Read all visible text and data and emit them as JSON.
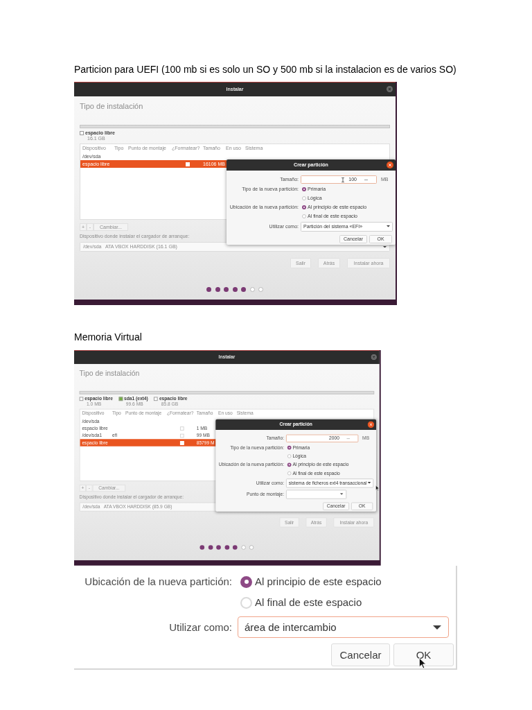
{
  "sections": [
    {
      "caption": "Particion para UEFI (100 mb si es solo un SO y 500 mb si la instalacion es de varios SO)",
      "screenshot": {
        "window_title": "Instalar",
        "heading": "Tipo de instalación",
        "legend": [
          {
            "label": "espacio libre",
            "size": "16.1 GB",
            "color": "#ffffff"
          }
        ],
        "table": {
          "columns": [
            "Dispositivo",
            "Tipo",
            "Punto de montaje",
            "¿Formatear?",
            "Tamaño",
            "En uso",
            "Sistema"
          ],
          "rows": [
            {
              "device": "/dev/sda",
              "selected": false
            },
            {
              "device": "espacio libre",
              "format": false,
              "size": "16106 MB",
              "selected": true
            }
          ]
        },
        "table_buttons": [
          {
            "label": "+",
            "disabled": true
          },
          {
            "label": "-",
            "disabled": true
          },
          {
            "label": "Cambiar...",
            "disabled": true
          }
        ],
        "bootloader": {
          "label": "Dispositivo donde instalar el cargador de arranque:",
          "value": "/dev/sda   ATA VBOX HARDDISK (16.1 GB)"
        },
        "buttons": [
          {
            "label": "Salir",
            "disabled": true
          },
          {
            "label": "Atrás",
            "disabled": true
          },
          {
            "label": "Instalar ahora",
            "disabled": true
          }
        ],
        "progress_dots": [
          {
            "filled": true
          },
          {
            "filled": true
          },
          {
            "filled": true
          },
          {
            "filled": true
          },
          {
            "filled": true
          },
          {
            "filled": false
          },
          {
            "filled": false
          }
        ],
        "dialog": {
          "title": "Crear partición",
          "size": {
            "label": "Tamaño:",
            "value": "100",
            "unit": "MB"
          },
          "type": {
            "label": "Tipo de la nueva partición:",
            "options": [
              {
                "label": "Primaria",
                "selected": true
              },
              {
                "label": "Lógica",
                "selected": false
              }
            ]
          },
          "location": {
            "label": "Ubicación de la nueva partición:",
            "options": [
              {
                "label": "Al principio de este espacio",
                "selected": true
              },
              {
                "label": "Al final de este espacio",
                "selected": false
              }
            ]
          },
          "use_as": {
            "label": "Utilizar como:",
            "value": "Partición del sistema «EFI»"
          },
          "buttons": [
            "Cancelar",
            "OK"
          ]
        }
      }
    },
    {
      "caption": "Memoria Virtual",
      "screenshot": {
        "window_title": "Instalar",
        "heading": "Tipo de instalación",
        "legend": [
          {
            "label": "espacio libre",
            "size": "1.0 MB",
            "color": "#ffffff"
          },
          {
            "label": "sda1 (ext4)",
            "size": "99.6 MB",
            "color": "#73b13f"
          },
          {
            "label": "espacio libre",
            "size": "85.8 GB",
            "color": "#ffffff"
          }
        ],
        "table": {
          "columns": [
            "Dispositivo",
            "Tipo",
            "Punto de montaje",
            "¿Formatear?",
            "Tamaño",
            "En uso",
            "Sistema"
          ],
          "rows": [
            {
              "device": "/dev/sda",
              "selected": false
            },
            {
              "device": "espacio libre",
              "format": false,
              "size": "1 MB",
              "selected": false
            },
            {
              "device": "/dev/sda1",
              "type": "efi",
              "format": false,
              "size": "99 MB",
              "selected": false
            },
            {
              "device": "espacio libre",
              "format": false,
              "size": "85799 M",
              "selected": true
            }
          ]
        },
        "table_buttons": [
          {
            "label": "+",
            "disabled": true
          },
          {
            "label": "-",
            "disabled": true
          },
          {
            "label": "Cambiar...",
            "disabled": true
          }
        ],
        "bootloader": {
          "label": "Dispositivo donde instalar el cargador de arranque:",
          "value": "/dev/sda   ATA VBOX HARDDISK (85.9 GB)"
        },
        "buttons": [
          {
            "label": "Salir",
            "disabled": true
          },
          {
            "label": "Atrás",
            "disabled": true
          },
          {
            "label": "Instalar ahora",
            "disabled": true
          }
        ],
        "progress_dots": [
          {
            "filled": true
          },
          {
            "filled": true
          },
          {
            "filled": true
          },
          {
            "filled": true
          },
          {
            "filled": true
          },
          {
            "filled": false
          },
          {
            "filled": false
          }
        ],
        "dialog": {
          "title": "Crear partición",
          "size": {
            "label": "Tamaño:",
            "value": "2000",
            "unit": "MB"
          },
          "type": {
            "label": "Tipo de la nueva partición:",
            "options": [
              {
                "label": "Primaria",
                "selected": true
              },
              {
                "label": "Lógica",
                "selected": false
              }
            ]
          },
          "location": {
            "label": "Ubicación de la nueva partición:",
            "options": [
              {
                "label": "Al principio de este espacio",
                "selected": true
              },
              {
                "label": "Al final de este espacio",
                "selected": false
              }
            ]
          },
          "use_as": {
            "label": "Utilizar como:",
            "value": "sistema de ficheros ext4 transaccional"
          },
          "mount_point": {
            "label": "Punto de montaje:"
          },
          "buttons": [
            "Cancelar",
            "OK"
          ]
        }
      },
      "detail": {
        "location": {
          "label": "Ubicación de la nueva partición:",
          "options": [
            {
              "label": "Al principio de este espacio",
              "selected": true
            },
            {
              "label": "Al final de este espacio",
              "selected": false
            }
          ]
        },
        "use_as": {
          "label": "Utilizar como:",
          "value": "área de intercambio"
        },
        "buttons": [
          "Cancelar",
          "OK"
        ]
      }
    }
  ]
}
